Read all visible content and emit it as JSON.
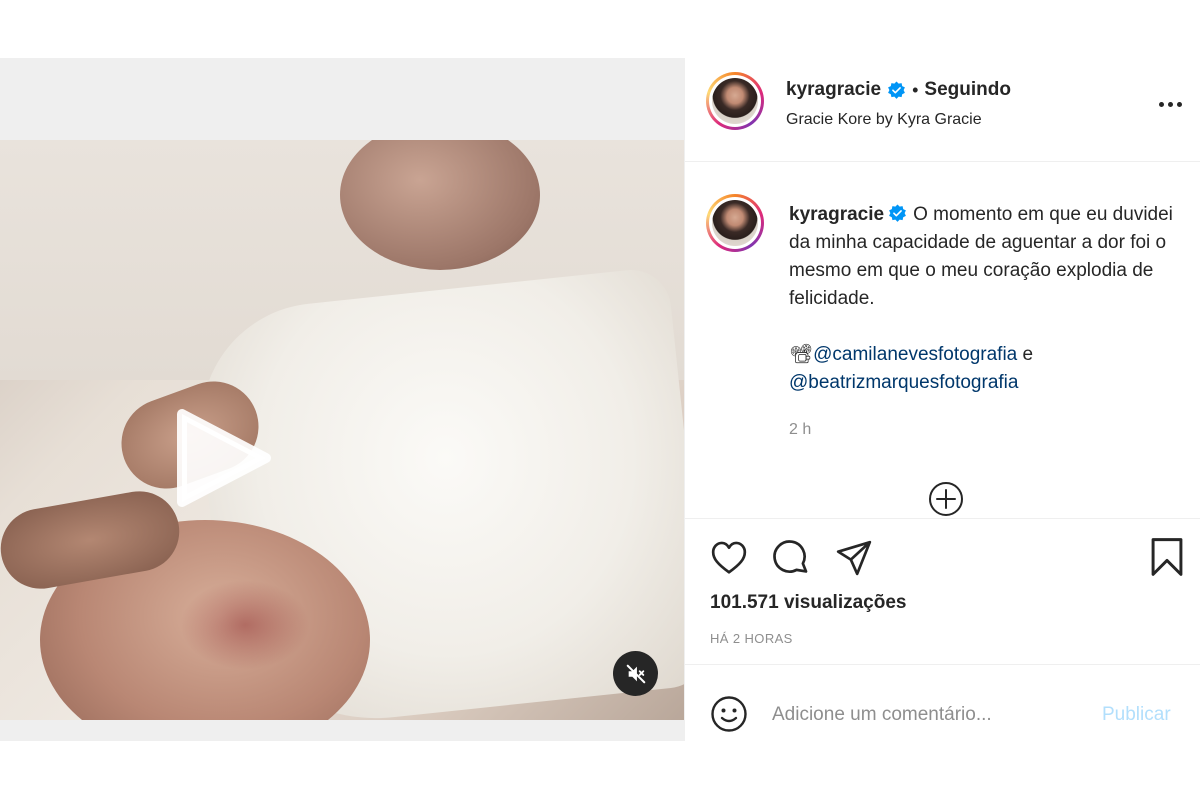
{
  "post": {
    "username": "kyragracie",
    "follow_state": "Seguindo",
    "separator": "•",
    "location": "Gracie Kore by Kyra Gracie"
  },
  "caption": {
    "username": "kyragracie",
    "text": "O momento em que eu duvidei da minha capacidade de aguentar a dor foi o mesmo em que o meu coração explodia de felicidade.",
    "camera_emoji": "📽",
    "mention_1": "@camilanevesfotografia",
    "connector": " e ",
    "mention_2": "@beatrizmarquesfotografia",
    "time": "2 h"
  },
  "stats": {
    "views": "101.571 visualizações",
    "posted": "HÁ 2 HORAS"
  },
  "comment": {
    "placeholder": "Adicione um comentário...",
    "publish_label": "Publicar"
  },
  "colors": {
    "verified": "#0095f6",
    "mention": "#00376b",
    "publish_disabled": "#b2dffc",
    "secondary_text": "#8e8e8e"
  },
  "icons": {
    "play": "play-icon",
    "mute": "muted-speaker-icon",
    "more": "ellipsis-icon",
    "verified": "verified-badge-icon",
    "load_more": "plus-circle-icon",
    "like": "heart-icon",
    "comment": "comment-bubble-icon",
    "share": "paper-plane-icon",
    "save": "bookmark-icon",
    "emoji": "smiley-icon"
  }
}
